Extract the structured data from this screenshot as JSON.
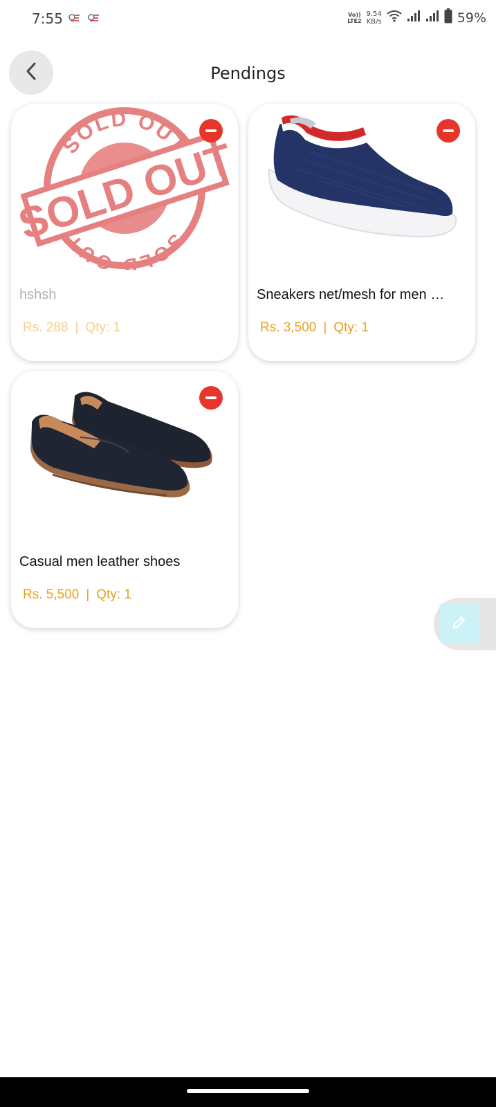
{
  "status_bar": {
    "time": "7:55",
    "network_label": "VoLTE2",
    "network_line1": "Vo))",
    "network_line2": "LTE2",
    "speed_value": "9.54",
    "speed_unit": "KB/s",
    "battery": "59%",
    "icons": [
      "notification-icon",
      "notification-icon",
      "wifi-icon",
      "signal-icon",
      "signal-icon",
      "battery-icon"
    ]
  },
  "header": {
    "title": "Pendings",
    "back_icon": "chevron-left-icon"
  },
  "products": [
    {
      "name": "hshsh",
      "price": "Rs. 288",
      "qty": "Qty: 1",
      "separator": "|",
      "sold_out": true,
      "stamp_text_main": "SOLD OUT",
      "stamp_text_top": "SOLD OUT",
      "stamp_text_bottom": "SOLD OUT",
      "image": "sold-out-stamp"
    },
    {
      "name": "Sneakers net/mesh for men …",
      "price": "Rs. 3,500",
      "qty": "Qty: 1",
      "separator": "|",
      "sold_out": false,
      "image": "navy-knit-sneaker"
    },
    {
      "name": "Casual men leather shoes",
      "price": "Rs. 5,500",
      "qty": "Qty: 1",
      "separator": "|",
      "sold_out": false,
      "image": "black-leather-loafers"
    }
  ],
  "fab": {
    "icon": "pencil-icon"
  },
  "colors": {
    "accent_price": "#e8a020",
    "remove_red": "#e8352b",
    "stamp_red": "#e26b6b",
    "fab_bg": "#ccf1f6"
  }
}
